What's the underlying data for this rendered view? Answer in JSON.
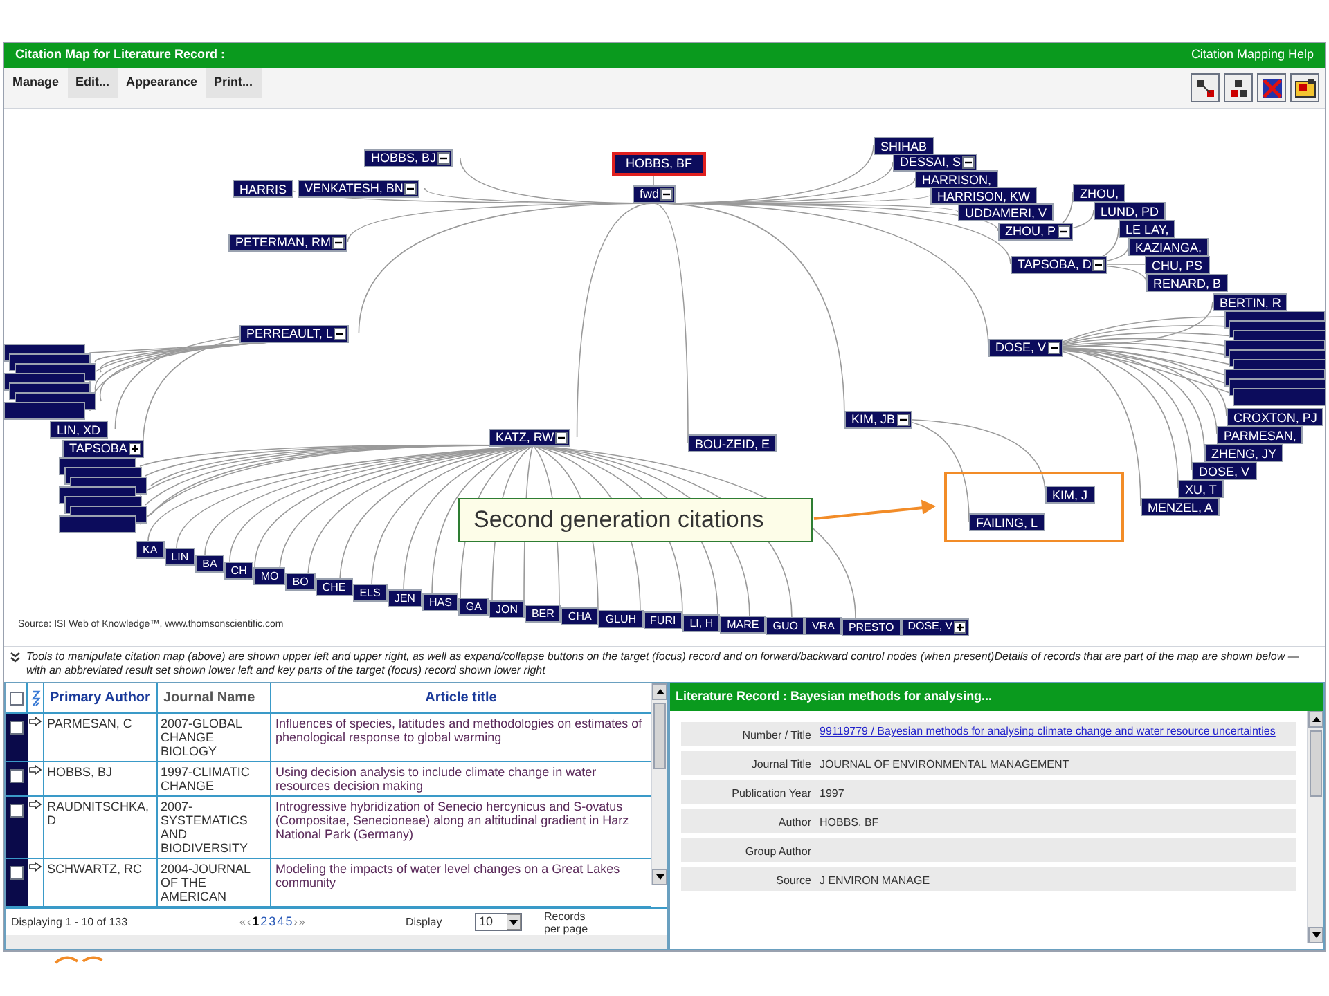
{
  "title_bar": {
    "title": "Citation Map for  Literature Record :",
    "help_link": "Citation Mapping Help"
  },
  "menu": [
    "Manage",
    "Edit...",
    "Appearance",
    "Print..."
  ],
  "map": {
    "focus": {
      "label": "HOBBS, BF",
      "selected": true
    },
    "root": {
      "label": "fwd",
      "kind": "branch",
      "expanded": true,
      "children": [
        {
          "label": "SHIHAB",
          "kind": "leaf"
        },
        {
          "label": "HOBBS, BJ",
          "kind": "branch",
          "expanded": true
        },
        {
          "label": "DESSAI, S",
          "kind": "branch",
          "expanded": true
        },
        {
          "label": "HARRISON,",
          "kind": "leaf"
        },
        {
          "label": "HARRIS",
          "kind": "leaf"
        },
        {
          "label": "VENKATESH, BN",
          "kind": "branch",
          "expanded": true
        },
        {
          "label": "HARRISON, KW",
          "kind": "leaf"
        },
        {
          "label": "UDDAMERI, V",
          "kind": "leaf"
        },
        {
          "label": "ZHOU, P",
          "kind": "branch",
          "expanded": true,
          "children": [
            {
              "label": "ZHOU,",
              "kind": "leaf"
            },
            {
              "label": "LUND, PD",
              "kind": "leaf"
            }
          ]
        },
        {
          "label": "PETERMAN, RM",
          "kind": "branch",
          "expanded": true
        },
        {
          "label": "TAPSOBA, D",
          "kind": "branch",
          "expanded": true,
          "children": [
            {
              "label": "LE LAY,",
              "kind": "leaf"
            },
            {
              "label": "KAZIANGA,",
              "kind": "leaf"
            },
            {
              "label": "CHU, PS",
              "kind": "leaf"
            },
            {
              "label": "RENARD, B",
              "kind": "leaf"
            }
          ]
        },
        {
          "label": "PERREAULT, L",
          "kind": "branch",
          "expanded": true,
          "children": [
            {
              "label": "LIN, XD",
              "kind": "leaf"
            },
            {
              "label": "TAPSOBA",
              "kind": "branch",
              "expanded": false
            }
          ]
        },
        {
          "label": "DOSE, V",
          "kind": "branch",
          "expanded": true,
          "children": [
            {
              "label": "BERTIN, R",
              "kind": "leaf"
            },
            {
              "label": "CROXTON, PJ",
              "kind": "leaf"
            },
            {
              "label": "PARMESAN,",
              "kind": "leaf"
            },
            {
              "label": "ZHENG, JY",
              "kind": "leaf"
            },
            {
              "label": "DOSE, V",
              "kind": "leaf"
            },
            {
              "label": "XU, T",
              "kind": "leaf"
            },
            {
              "label": "MENZEL, A",
              "kind": "leaf"
            }
          ]
        },
        {
          "label": "KIM, JB",
          "kind": "branch",
          "expanded": true,
          "children": [
            {
              "label": "KIM, J",
              "kind": "leaf"
            },
            {
              "label": "FAILING, L",
              "kind": "leaf"
            }
          ]
        },
        {
          "label": "KATZ, RW",
          "kind": "branch",
          "expanded": true,
          "children": [
            {
              "label": "KA",
              "kind": "leaf"
            },
            {
              "label": "LIN",
              "kind": "leaf"
            },
            {
              "label": "BA",
              "kind": "leaf"
            },
            {
              "label": "CH",
              "kind": "leaf"
            },
            {
              "label": "MO",
              "kind": "leaf"
            },
            {
              "label": "BO",
              "kind": "leaf"
            },
            {
              "label": "CHE",
              "kind": "leaf"
            },
            {
              "label": "ELS",
              "kind": "leaf"
            },
            {
              "label": "JEN",
              "kind": "leaf"
            },
            {
              "label": "HAS",
              "kind": "leaf"
            },
            {
              "label": "GA",
              "kind": "leaf"
            },
            {
              "label": "JON",
              "kind": "leaf"
            },
            {
              "label": "BER",
              "kind": "leaf"
            },
            {
              "label": "CHA",
              "kind": "leaf"
            },
            {
              "label": "GLUH",
              "kind": "leaf"
            },
            {
              "label": "FURI",
              "kind": "leaf"
            },
            {
              "label": "LI, H",
              "kind": "leaf"
            },
            {
              "label": "MARE",
              "kind": "leaf"
            },
            {
              "label": "GUO",
              "kind": "leaf"
            },
            {
              "label": "VRA",
              "kind": "leaf"
            },
            {
              "label": "PRESTO",
              "kind": "leaf"
            },
            {
              "label": "DOSE, V",
              "kind": "branch",
              "expanded": false
            }
          ]
        },
        {
          "label": "BOU-ZEID, E",
          "kind": "leaf"
        }
      ]
    },
    "callout": "Second generation citations",
    "source": "Source: ISI Web of Knowledge™, www.thomsonscientific.com"
  },
  "info_text": "Tools to manipulate citation map (above) are shown upper left and upper right, as well as expand/collapse buttons on the target (focus) record and on forward/backward control nodes (when present)Details of records that are part of the map are shown below — with an abbreviated result set shown lower left and key parts of the target (focus) record shown lower right",
  "results": {
    "select_all_checked": false,
    "columns": [
      "Primary Author",
      "Journal Name",
      "Article title"
    ],
    "rows": [
      {
        "checked": false,
        "author": "PARMESAN, C",
        "journal": "2007-GLOBAL CHANGE BIOLOGY",
        "title": "Influences of species, latitudes and methodologies on estimates of phenological response to global warming"
      },
      {
        "checked": false,
        "author": "HOBBS, BJ",
        "journal": "1997-CLIMATIC CHANGE",
        "title": "Using decision analysis to include climate change in water resources decision making"
      },
      {
        "checked": false,
        "author": "RAUDNITSCHKA, D",
        "journal": "2007-SYSTEMATICS AND BIODIVERSITY",
        "title": "Introgressive hybridization of Senecio hercynicus and S-ovatus (Compositae, Senecioneae) along an altitudinal gradient in Harz National Park (Germany)"
      },
      {
        "checked": false,
        "author": "SCHWARTZ, RC",
        "journal": "2004-JOURNAL OF THE AMERICAN",
        "title": "Modeling the impacts of water level changes on a Great Lakes community"
      }
    ],
    "status": "Displaying 1 - 10 of 133",
    "pages": [
      {
        "label": "«",
        "kind": "arrow",
        "selected": false
      },
      {
        "label": "‹",
        "kind": "arrow",
        "selected": false
      },
      {
        "label": "1",
        "kind": "page",
        "selected": true
      },
      {
        "label": "2",
        "kind": "page",
        "selected": false
      },
      {
        "label": "3",
        "kind": "page",
        "selected": false
      },
      {
        "label": "4",
        "kind": "page",
        "selected": false
      },
      {
        "label": "5",
        "kind": "page",
        "selected": false
      },
      {
        "label": "›",
        "kind": "arrow",
        "selected": false
      },
      {
        "label": "»",
        "kind": "arrow",
        "selected": false
      }
    ],
    "display_label": "Display",
    "page_size": "10",
    "per_page_label": "Records per page"
  },
  "record": {
    "header": "Literature Record : Bayesian methods for analysing...",
    "fields": [
      {
        "label": "Number / Title",
        "kind": "link",
        "value": "99119779 / Bayesian methods for analysing climate change and water resource uncertainties"
      },
      {
        "label": "Journal Title",
        "kind": "text",
        "value": "JOURNAL OF ENVIRONMENTAL MANAGEMENT"
      },
      {
        "label": "Publication Year",
        "kind": "text",
        "value": "1997"
      },
      {
        "label": "Author",
        "kind": "text",
        "value": "HOBBS, BF"
      },
      {
        "label": "Group Author",
        "kind": "text"
      },
      {
        "label": "Source",
        "kind": "text",
        "value": "J ENVIRON MANAGE"
      }
    ]
  }
}
